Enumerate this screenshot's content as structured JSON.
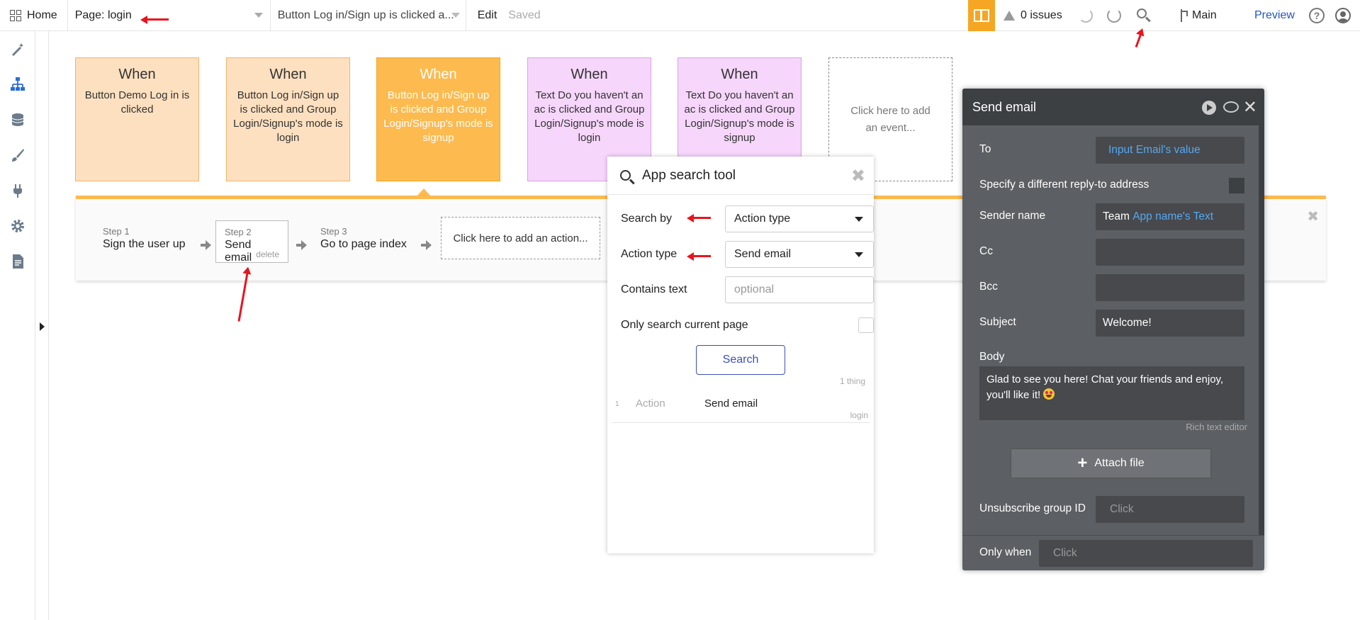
{
  "topbar": {
    "home_label": "Home",
    "page_label": "Page: login",
    "workflow_label": "Button Log in/Sign up is clicked a...",
    "edit_label": "Edit",
    "saved_label": "Saved",
    "issues_label": "0 issues",
    "branch_label": "Main",
    "preview_label": "Preview",
    "help_label": "?"
  },
  "events": [
    {
      "title": "When",
      "desc": "Button Demo Log in is clicked"
    },
    {
      "title": "When",
      "desc": "Button Log in/Sign up is clicked and Group Login/Signup's mode is login"
    },
    {
      "title": "When",
      "desc": "Button Log in/Sign up is clicked and Group Login/Signup's mode is signup"
    },
    {
      "title": "When",
      "desc": "Text Do you haven't an ac is clicked and Group Login/Signup's mode is login"
    },
    {
      "title": "When",
      "desc": "Text Do you haven't an ac is clicked and Group Login/Signup's mode is signup"
    }
  ],
  "add_event_label": "Click here to add an event...",
  "steps": [
    {
      "num": "Step 1",
      "name": "Sign the user up"
    },
    {
      "num": "Step 2",
      "name": "Send email",
      "delete": "delete"
    },
    {
      "num": "Step 3",
      "name": "Go to page index"
    }
  ],
  "add_action_label": "Click here to add an action...",
  "search_tool": {
    "title": "App search tool",
    "search_by_label": "Search by",
    "search_by_value": "Action type",
    "action_type_label": "Action type",
    "action_type_value": "Send email",
    "contains_text_label": "Contains text",
    "contains_text_placeholder": "optional",
    "only_current_label": "Only search current page",
    "search_button": "Search",
    "count": "1 thing",
    "results": [
      {
        "index": "1",
        "type": "Action",
        "name": "Send email",
        "page": "login"
      }
    ]
  },
  "email_panel": {
    "title": "Send email",
    "to_label": "To",
    "to_value": "Input Email's value",
    "reply_to_label": "Specify a different reply-to address",
    "sender_label": "Sender name",
    "sender_static": "Team ",
    "sender_dynamic": "App name's Text",
    "cc_label": "Cc",
    "bcc_label": "Bcc",
    "subject_label": "Subject",
    "subject_value": "Welcome!",
    "body_label": "Body",
    "body_value": "Glad to see you here! Chat your friends and enjoy, you'll like it!",
    "rich_text_label": "Rich text editor",
    "attach_label": "Attach file",
    "unsubscribe_label": "Unsubscribe group ID",
    "unsubscribe_placeholder": "Click",
    "only_when_label": "Only when",
    "only_when_placeholder": "Click"
  },
  "colors": {
    "accent_orange": "#f5a623",
    "event_peach": "#fde0bf",
    "event_pink": "#f6d6fb",
    "dynamic_blue": "#55a8f2",
    "annotation_red": "#e8141e"
  }
}
